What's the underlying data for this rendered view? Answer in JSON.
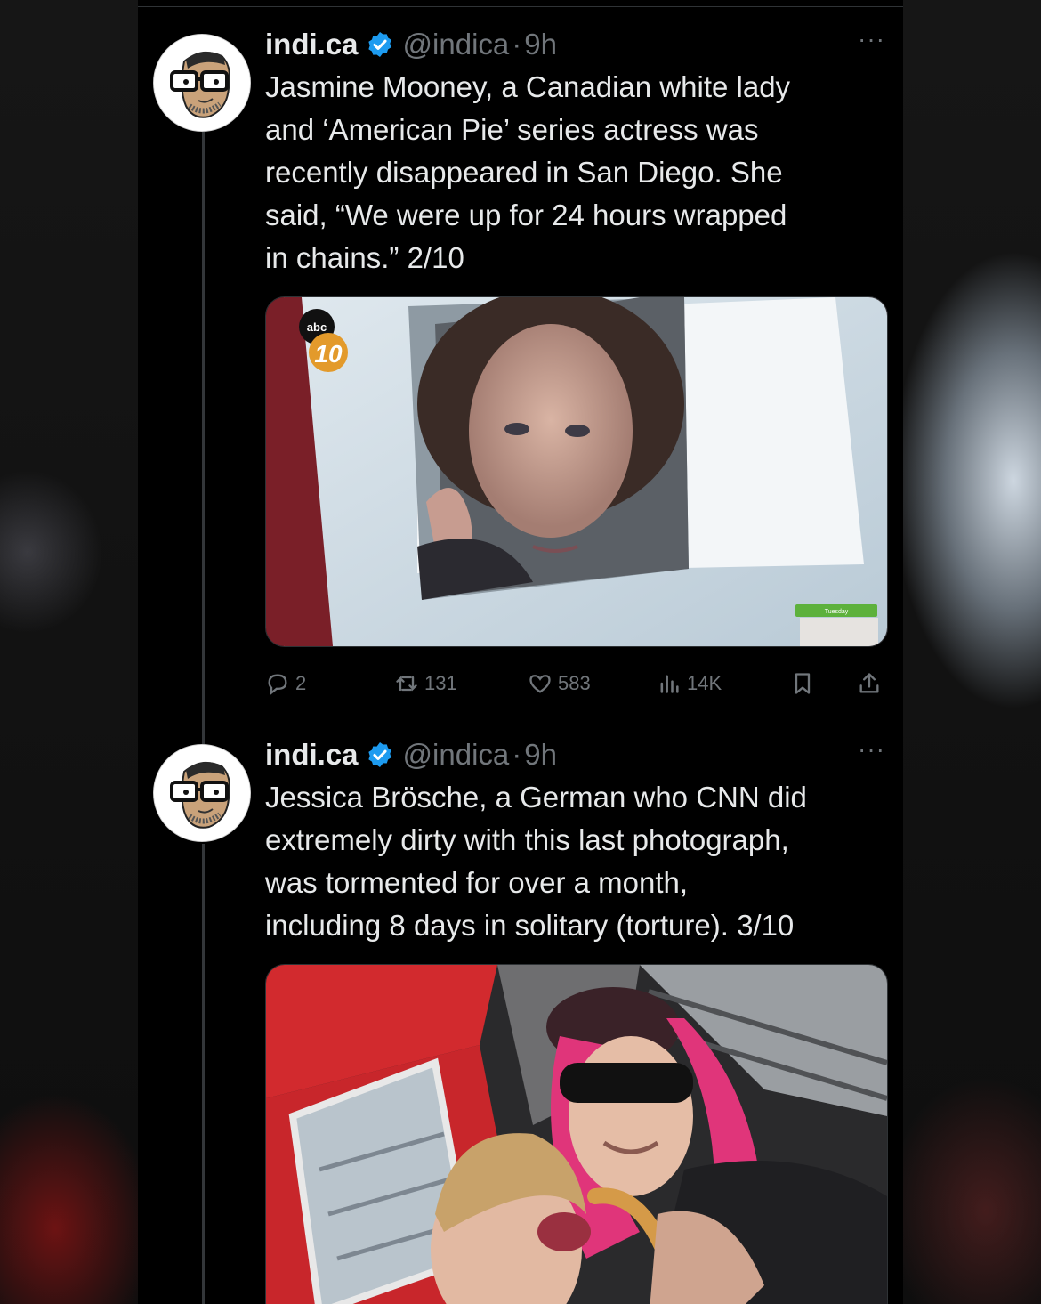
{
  "tweets": [
    {
      "name": "indi.ca",
      "handle": "@indica",
      "separator": "·",
      "time": "9h",
      "more": "···",
      "text_lines": [
        "Jasmine Mooney, a Canadian white lady",
        "and ‘American Pie’ series actress was",
        "recently disappeared in San Diego. She",
        "said, “We were up for 24 hours wrapped",
        "in chains.” 2/10"
      ],
      "media": {
        "logo_top": "abc",
        "logo_bottom": "10",
        "corner_badge": "Tuesday"
      },
      "stats": {
        "replies": "2",
        "reposts": "131",
        "likes": "583",
        "views": "14K"
      }
    },
    {
      "name": "indi.ca",
      "handle": "@indica",
      "separator": "·",
      "time": "9h",
      "more": "···",
      "text_lines": [
        "Jessica Brösche, a German who CNN did",
        "extremely dirty with this last photograph,",
        "was tormented for over a month,",
        "including 8 days in solitary (torture). 3/10"
      ]
    }
  ],
  "colors": {
    "background": "#000000",
    "text": "#e7e9ea",
    "muted": "#71767b",
    "verified": "#1d9bf0"
  },
  "icons": [
    "verified-badge-icon",
    "more-icon",
    "reply-icon",
    "repost-icon",
    "like-icon",
    "views-icon",
    "bookmark-icon",
    "share-icon"
  ]
}
